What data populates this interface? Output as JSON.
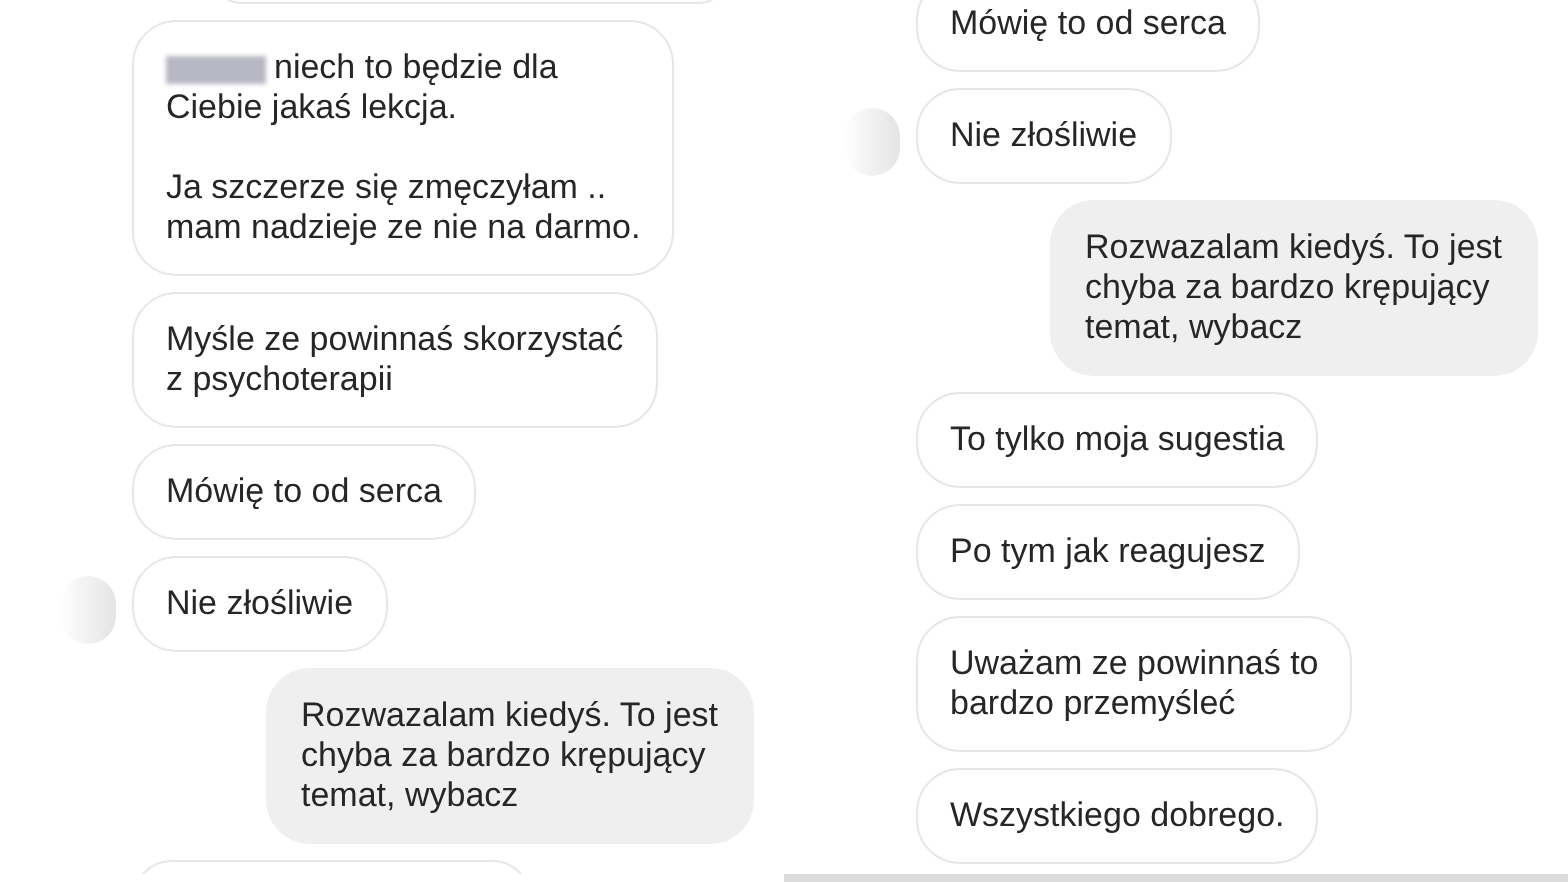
{
  "panels": [
    {
      "messages": [
        {
          "kind": "cut_top"
        },
        {
          "kind": "incoming",
          "redacted": true,
          "avatar": false,
          "text": "niech to będzie dla\nCiebie jakaś lekcja.\n\nJa szczerze się zmęczyłam ..\nmam nadzieje ze nie na darmo."
        },
        {
          "kind": "incoming",
          "redacted": false,
          "avatar": false,
          "text": "Myśle ze powinnaś skorzystać\nz psychoterapii"
        },
        {
          "kind": "incoming",
          "redacted": false,
          "avatar": false,
          "text": "Mówię to od serca"
        },
        {
          "kind": "incoming",
          "redacted": false,
          "avatar": true,
          "text": "Nie złośliwie"
        },
        {
          "kind": "outgoing",
          "redacted": false,
          "avatar": false,
          "text": "Rozwazalam kiedyś. To jest\nchyba za bardzo krępujący\ntemat, wybacz"
        },
        {
          "kind": "cut_bottom"
        }
      ]
    },
    {
      "messages": [
        {
          "kind": "incoming",
          "redacted": false,
          "avatar": false,
          "text": "Mówię to od serca"
        },
        {
          "kind": "incoming",
          "redacted": false,
          "avatar": true,
          "text": "Nie złośliwie"
        },
        {
          "kind": "outgoing",
          "redacted": false,
          "avatar": false,
          "text": "Rozwazalam kiedyś. To jest\nchyba za bardzo krępujący\ntemat, wybacz"
        },
        {
          "kind": "incoming",
          "redacted": false,
          "avatar": false,
          "text": "To tylko moja sugestia"
        },
        {
          "kind": "incoming",
          "redacted": false,
          "avatar": false,
          "text": "Po tym jak reagujesz"
        },
        {
          "kind": "incoming",
          "redacted": false,
          "avatar": false,
          "text": "Uważam ze powinnaś to\nbardzo przemyśleć"
        },
        {
          "kind": "incoming",
          "redacted": false,
          "avatar": false,
          "text": "Wszystkiego dobrego."
        }
      ]
    }
  ]
}
